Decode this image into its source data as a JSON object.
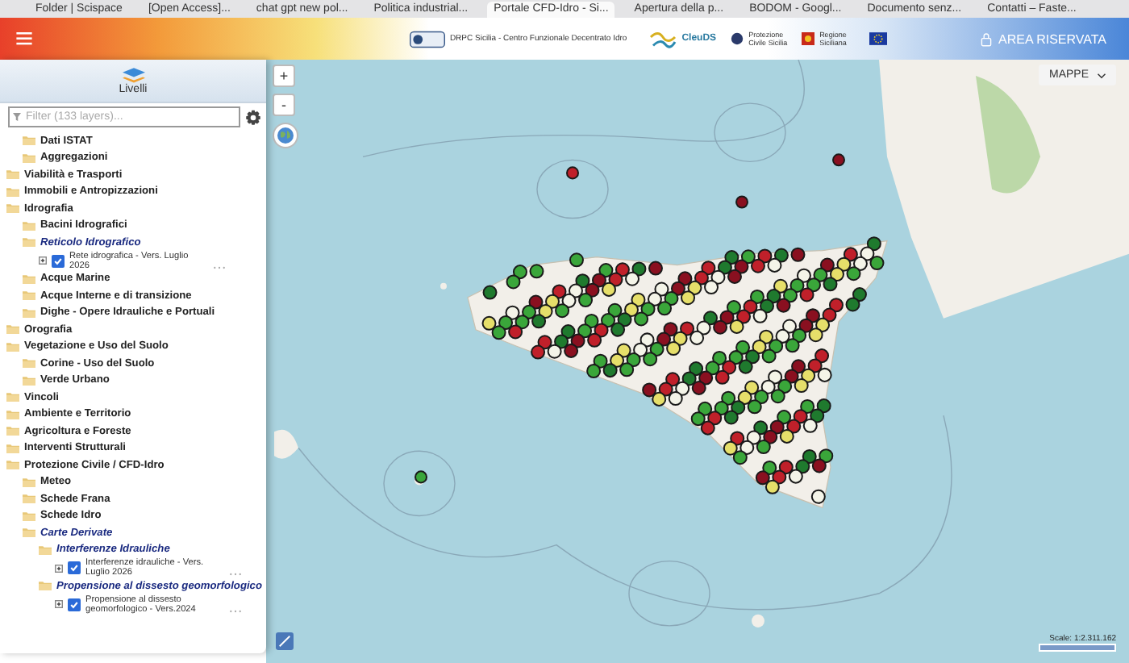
{
  "browser_tabs": [
    {
      "label": "Folder | Scispace",
      "selected": false
    },
    {
      "label": "[Open Access]...",
      "selected": false
    },
    {
      "label": "chat gpt new pol...",
      "selected": false
    },
    {
      "label": "Politica industrial...",
      "selected": false
    },
    {
      "label": "Portale CFD-Idro - Si...",
      "selected": true
    },
    {
      "label": "Apertura della p...",
      "selected": false
    },
    {
      "label": "BODOM - Googl...",
      "selected": false
    },
    {
      "label": "Documento senz...",
      "selected": false
    },
    {
      "label": "Contatti – Faste...",
      "selected": false
    }
  ],
  "header": {
    "logo_text": "DRPC Sicilia - Centro Funzionale Decentrato Idro",
    "cfd_logo_text": "CleuDS",
    "protezione_text": "Protezione Civile Sicilia",
    "regione_text": "Regione Siciliana",
    "reserved_area": "AREA RISERVATA"
  },
  "sidebar": {
    "title": "Livelli",
    "filter": {
      "placeholder": "Filter (133 layers)..."
    },
    "tree": {
      "continued_children": [
        {
          "kind": "folder",
          "label": "Dati ISTAT",
          "emphasized": false
        },
        {
          "kind": "folder",
          "label": "Aggregazioni",
          "emphasized": false
        }
      ],
      "items": [
        {
          "kind": "folder",
          "label": "Viabilità e Trasporti",
          "emphasized": false
        },
        {
          "kind": "folder",
          "label": "Immobili e Antropizzazioni",
          "emphasized": false
        },
        {
          "kind": "folder",
          "label": "Idrografia",
          "emphasized": false,
          "children": [
            {
              "kind": "folder",
              "label": "Bacini Idrografici",
              "emphasized": false
            },
            {
              "kind": "folder",
              "label": "Reticolo Idrografico",
              "emphasized": true,
              "children": [
                {
                  "kind": "layer",
                  "label": "Rete idrografica - Vers. Luglio 2026",
                  "checked": true
                }
              ]
            },
            {
              "kind": "folder",
              "label": "Acque Marine",
              "emphasized": false
            },
            {
              "kind": "folder",
              "label": "Acque Interne e di transizione",
              "emphasized": false
            },
            {
              "kind": "folder",
              "label": "Dighe - Opere Idrauliche e Portuali",
              "emphasized": false
            }
          ]
        },
        {
          "kind": "folder",
          "label": "Orografia",
          "emphasized": false
        },
        {
          "kind": "folder",
          "label": "Vegetazione e Uso del Suolo",
          "emphasized": false,
          "children": [
            {
              "kind": "folder",
              "label": "Corine - Uso del Suolo",
              "emphasized": false
            },
            {
              "kind": "folder",
              "label": "Verde Urbano",
              "emphasized": false
            }
          ]
        },
        {
          "kind": "folder",
          "label": "Vincoli",
          "emphasized": false
        },
        {
          "kind": "folder",
          "label": "Ambiente e Territorio",
          "emphasized": false
        },
        {
          "kind": "folder",
          "label": "Agricoltura e Foreste",
          "emphasized": false
        },
        {
          "kind": "folder",
          "label": "Interventi Strutturali",
          "emphasized": false
        },
        {
          "kind": "folder",
          "label": "Protezione Civile / CFD-Idro",
          "emphasized": false,
          "children": [
            {
              "kind": "folder",
              "label": "Meteo",
              "emphasized": false
            },
            {
              "kind": "folder",
              "label": "Schede Frana",
              "emphasized": false
            },
            {
              "kind": "folder",
              "label": "Schede Idro",
              "emphasized": false
            },
            {
              "kind": "folder",
              "label": "Carte Derivate",
              "emphasized": true,
              "children": [
                {
                  "kind": "folder",
                  "label": "Interferenze Idrauliche",
                  "emphasized": true,
                  "children": [
                    {
                      "kind": "layer",
                      "label": "Interferenze idrauliche - Vers. Luglio 2026",
                      "checked": true
                    }
                  ]
                },
                {
                  "kind": "folder",
                  "label": "Propensione al dissesto geomorfologico",
                  "emphasized": true,
                  "children": [
                    {
                      "kind": "layer",
                      "label": "Propensione al dissesto geomorfologico - Vers.2024",
                      "checked": true
                    }
                  ]
                }
              ]
            }
          ]
        }
      ]
    }
  },
  "map": {
    "zoom_in": "+",
    "zoom_out": "-",
    "basemap_menu": "MAPPE",
    "scale": "Scale: 1:2.311.162"
  }
}
